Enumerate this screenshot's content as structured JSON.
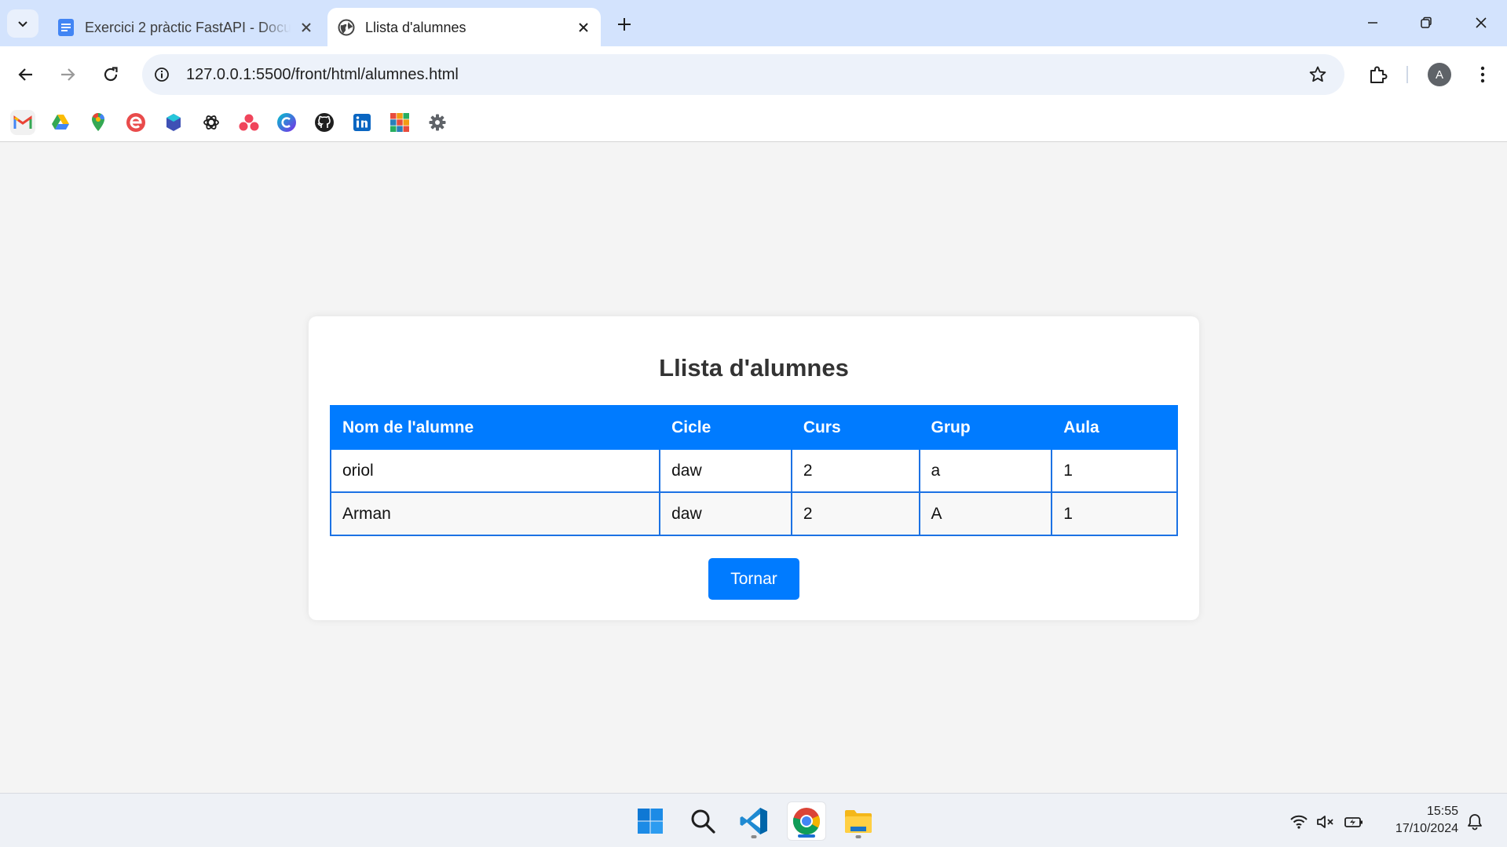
{
  "browser": {
    "tabs": [
      {
        "title": "Exercici 2 pràctic FastAPI - Docu",
        "favicon": "google-docs-icon",
        "active": false
      },
      {
        "title": "Llista d'alumnes",
        "favicon": "globe-icon",
        "active": true
      }
    ],
    "address": "127.0.0.1:5500/front/html/alumnes.html",
    "profile_initial": "A",
    "bookmarks": [
      "gmail-icon",
      "google-drive-icon",
      "google-maps-icon",
      "edpuzzle-icon",
      "layers-app-icon",
      "openai-icon",
      "asana-icon",
      "canva-icon",
      "github-icon",
      "linkedin-icon",
      "tinkercad-icon",
      "settings-gear-icon"
    ]
  },
  "page": {
    "title": "Llista d'alumnes",
    "table": {
      "headers": [
        "Nom de l'alumne",
        "Cicle",
        "Curs",
        "Grup",
        "Aula"
      ],
      "rows": [
        [
          "oriol",
          "daw",
          "2",
          "a",
          "1"
        ],
        [
          "Arman",
          "daw",
          "2",
          "A",
          "1"
        ]
      ]
    },
    "back_button": "Tornar"
  },
  "taskbar": {
    "apps": [
      "windows-start-icon",
      "search-icon",
      "vscode-icon",
      "chrome-icon",
      "file-explorer-icon"
    ],
    "time": "15:55",
    "date": "17/10/2024"
  },
  "colors": {
    "accent": "#007bff",
    "tabstrip": "#d3e3fd",
    "page_bg": "#f4f4f4"
  }
}
